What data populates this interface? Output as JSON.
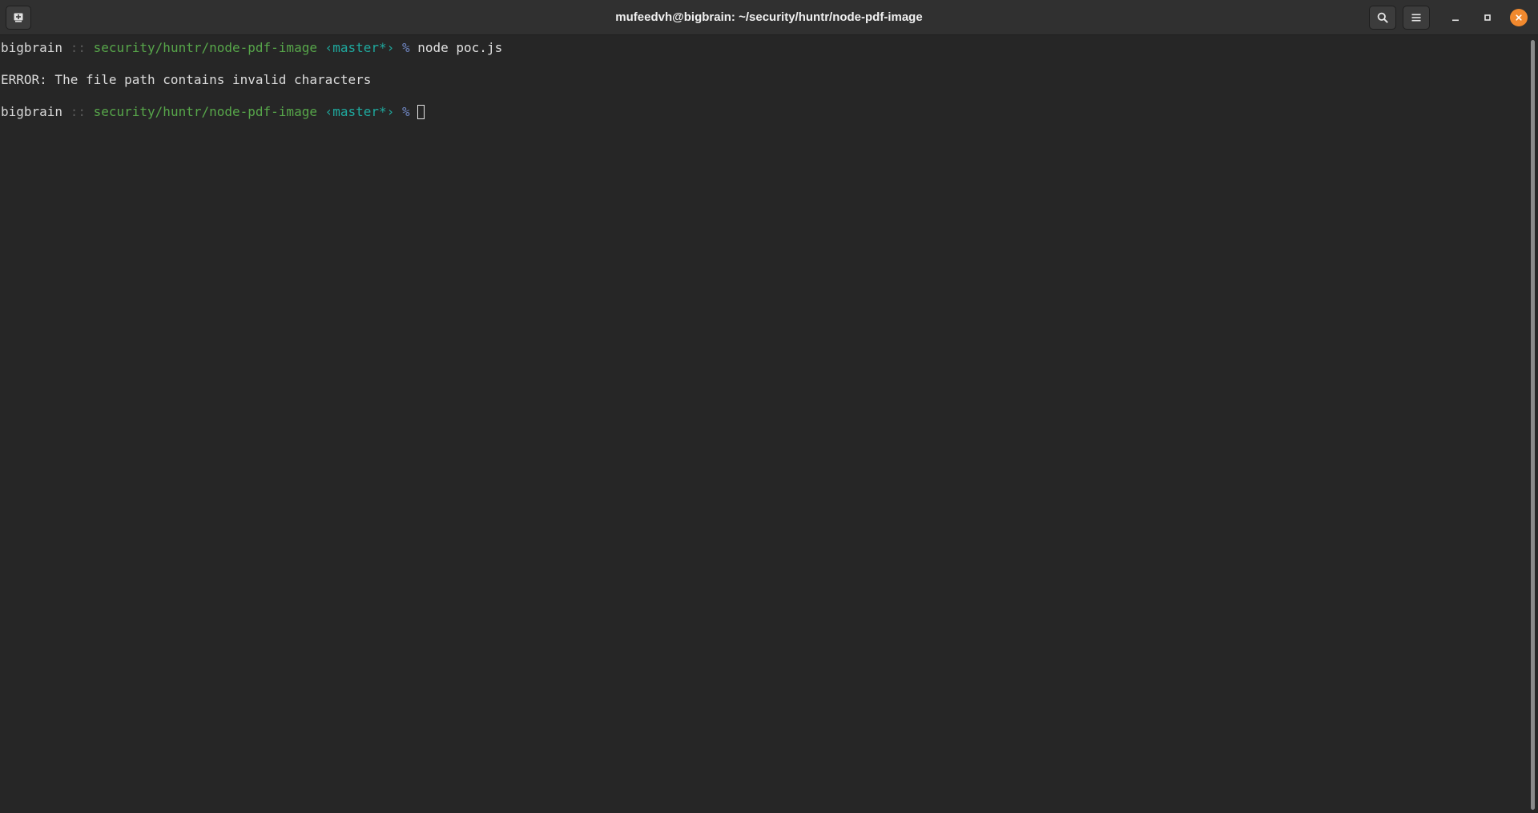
{
  "window": {
    "title": "mufeedvh@bigbrain: ~/security/huntr/node-pdf-image"
  },
  "header": {
    "new_tab_icon": "new-tab-icon",
    "search_icon": "search-icon",
    "menu_icon": "hamburger-menu-icon",
    "minimize_icon": "minimize-icon",
    "maximize_icon": "maximize-icon",
    "close_icon": "close-icon"
  },
  "colors": {
    "background": "#262626",
    "titlebar": "#303030",
    "path": "#57a64a",
    "branch": "#1fa99e",
    "prompt_sign": "#6f86c2",
    "close_button": "#f1892e"
  },
  "terminal": {
    "prompt1": {
      "host": "bigbrain",
      "separator": "::",
      "path": "security/huntr/node-pdf-image",
      "branch": "‹master*›",
      "sign": "%",
      "command": "node poc.js"
    },
    "output": "ERROR: The file path contains invalid characters",
    "prompt2": {
      "host": "bigbrain",
      "separator": "::",
      "path": "security/huntr/node-pdf-image",
      "branch": "‹master*›",
      "sign": "%",
      "command": ""
    }
  }
}
